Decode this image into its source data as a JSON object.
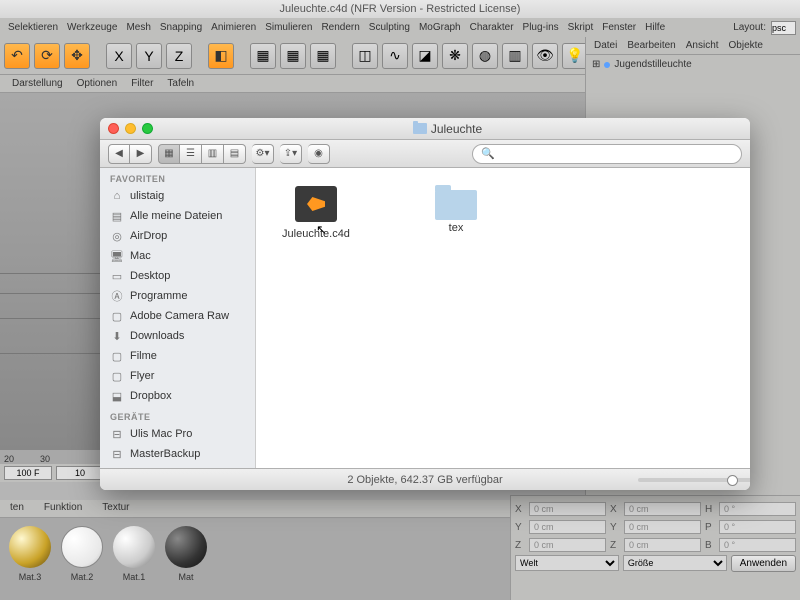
{
  "c4d": {
    "title": "Juleuchte.c4d (NFR Version - Restricted License)",
    "menu": [
      "Selektieren",
      "Werkzeuge",
      "Mesh",
      "Snapping",
      "Animieren",
      "Simulieren",
      "Rendern",
      "Sculpting",
      "MoGraph",
      "Charakter",
      "Plug-ins",
      "Skript",
      "Fenster",
      "Hilfe"
    ],
    "layout_label": "Layout:",
    "layout_value": "psc",
    "subtool": [
      "Darstellung",
      "Optionen",
      "Filter",
      "Tafeln"
    ],
    "right_menu": [
      "Datei",
      "Bearbeiten",
      "Ansicht",
      "Objekte"
    ],
    "tree_item": "Jugendstilleuchte",
    "timeline": {
      "marks": [
        "20",
        "30"
      ],
      "frame": "100 F",
      "max": "10"
    },
    "tabs2": [
      "ten",
      "Funktion",
      "Textur"
    ],
    "materials": [
      {
        "name": "Mat.3",
        "style": "gold"
      },
      {
        "name": "Mat.2",
        "style": "white"
      },
      {
        "name": "Mat.1",
        "style": "silver"
      },
      {
        "name": "Mat",
        "style": "dark"
      }
    ],
    "props": {
      "rows": [
        {
          "l1": "X",
          "v1": "0 cm",
          "l2": "X",
          "v2": "0 cm",
          "l3": "H",
          "v3": "0 °"
        },
        {
          "l1": "Y",
          "v1": "0 cm",
          "l2": "Y",
          "v2": "0 cm",
          "l3": "P",
          "v3": "0 °"
        },
        {
          "l1": "Z",
          "v1": "0 cm",
          "l2": "Z",
          "v2": "0 cm",
          "l3": "B",
          "v3": "0 °"
        }
      ],
      "sel1": "Welt",
      "sel2": "Größe",
      "apply": "Anwenden"
    }
  },
  "finder": {
    "title": "Juleuchte",
    "search_placeholder": "",
    "sidebar": {
      "fav_header": "FAVORITEN",
      "favorites": [
        {
          "icon": "home",
          "label": "ulistaig"
        },
        {
          "icon": "all",
          "label": "Alle meine Dateien"
        },
        {
          "icon": "airdrop",
          "label": "AirDrop"
        },
        {
          "icon": "mac",
          "label": "Mac"
        },
        {
          "icon": "desktop",
          "label": "Desktop"
        },
        {
          "icon": "apps",
          "label": "Programme"
        },
        {
          "icon": "folder",
          "label": "Adobe Camera Raw"
        },
        {
          "icon": "downloads",
          "label": "Downloads"
        },
        {
          "icon": "folder",
          "label": "Filme"
        },
        {
          "icon": "folder",
          "label": "Flyer"
        },
        {
          "icon": "dropbox",
          "label": "Dropbox"
        }
      ],
      "dev_header": "GERÄTE",
      "devices": [
        {
          "icon": "drive",
          "label": "Ulis Mac Pro"
        },
        {
          "icon": "drive",
          "label": "MasterBackup"
        }
      ]
    },
    "files": [
      {
        "name": "Juleuchte.c4d",
        "type": "c4d"
      },
      {
        "name": "tex",
        "type": "folder"
      }
    ],
    "status": "2 Objekte, 642.37 GB verfügbar"
  }
}
